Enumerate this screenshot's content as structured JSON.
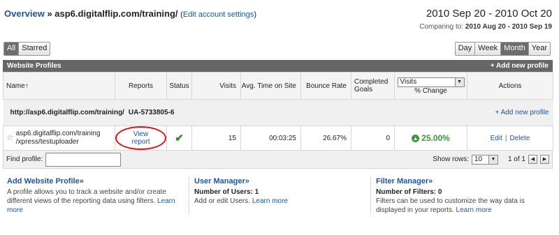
{
  "header": {
    "overview": "Overview",
    "path": " » asp6.digitalflip.com/training/",
    "edit_account": "(Edit account settings)",
    "open_paren": "(",
    "close_paren": ")",
    "edit_account_link": "Edit account settings",
    "date_range": "2010 Sep 20 - 2010 Oct 20",
    "comparing_label": "Comparing to:",
    "comparing_range": "2010 Aug 20 - 2010 Sep 19"
  },
  "toggles_left": [
    "All",
    "Starred"
  ],
  "toggles_left_selected": "All",
  "toggles_right": [
    "Day",
    "Week",
    "Month",
    "Year"
  ],
  "toggles_right_selected": "Month",
  "panel": {
    "title": "Website Profiles",
    "add_new": "+ Add new profile"
  },
  "columns": {
    "name": "Name",
    "sort_arrow": "↑",
    "reports": "Reports",
    "status": "Status",
    "visits": "Visits",
    "avg_time": "Avg. Time on Site",
    "bounce": "Bounce Rate",
    "completed": "Completed Goals",
    "metric_select": "Visits",
    "pct_change": "% Change",
    "actions": "Actions"
  },
  "group": {
    "url": "http://asp6.digitalflip.com/training/",
    "ua": "UA-5733805-6",
    "add_profile": "+ Add new profile"
  },
  "row": {
    "name_line1": "asp6.digitalflip.com/training",
    "name_line2": "/xpress/testuploader",
    "report_link": "View report",
    "status_icon": "check-icon",
    "visits": "15",
    "avg_time": "00:03:25",
    "bounce": "26.67%",
    "completed": "0",
    "pct": "25.00%",
    "edit": "Edit",
    "sep": "|",
    "delete": "Delete"
  },
  "footer": {
    "find_label": "Find profile:",
    "find_value": "",
    "show_rows_label": "Show rows:",
    "show_rows_value": "10",
    "page_info": "1 of 1"
  },
  "info": {
    "add_title": "Add Website Profile»",
    "add_text": "A profile allows you to track a website and/or create different views of the reporting data using filters.",
    "learn_more": "Learn more",
    "user_title": "User Manager»",
    "users_label": "Number of Users: 1",
    "user_text": "Add or edit Users.",
    "filter_title": "Filter Manager»",
    "filters_label": "Number of Filters: 0",
    "filter_text": "Filters can be used to customize the way data is displayed in your reports."
  },
  "colors": {
    "accent": "#1a55aa",
    "title_bar": "#666666",
    "positive": "#3a9a3a",
    "highlight_oval": "#e01010"
  }
}
